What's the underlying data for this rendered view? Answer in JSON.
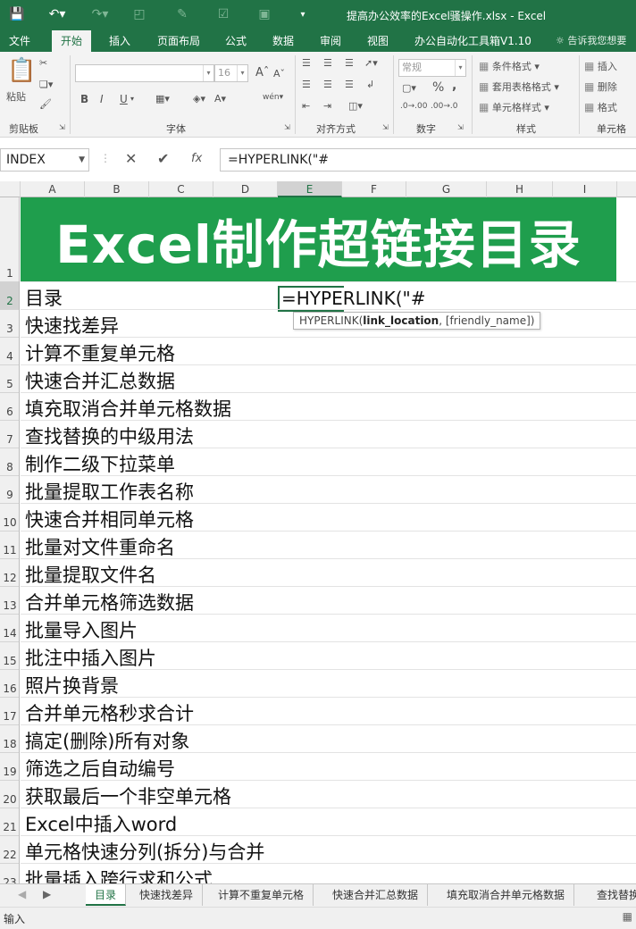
{
  "window": {
    "title": "提高办公效率的Excel骚操作.xlsx - Excel"
  },
  "ribbon_tabs": [
    "文件",
    "开始",
    "插入",
    "页面布局",
    "公式",
    "数据",
    "审阅",
    "视图",
    "办公自动化工具箱V1.10"
  ],
  "tell_me": "告诉我您想要",
  "ribbon": {
    "clipboard": {
      "label": "剪贴板",
      "paste": "粘贴"
    },
    "font": {
      "label": "字体",
      "size": "16",
      "bold": "B",
      "italic": "I",
      "underline": "U",
      "grow": "A",
      "shrink": "A",
      "font_color": "A",
      "phonetic": "wén"
    },
    "alignment": {
      "label": "对齐方式"
    },
    "number": {
      "label": "数字",
      "format": "常规",
      "percent": "%",
      "comma": ",",
      "dec_inc": ".0→.00",
      "dec_dec": ".00→.0"
    },
    "styles": {
      "label": "样式",
      "conditional": "条件格式",
      "table": "套用表格格式",
      "cell": "单元格样式"
    },
    "cells": {
      "label": "单元格",
      "insert": "插入",
      "delete": "删除",
      "format": "格式"
    }
  },
  "formula_bar": {
    "name_box": "INDEX",
    "fx": "fx",
    "cancel": "✕",
    "enter": "✔",
    "formula": "=HYPERLINK(\"#"
  },
  "columns": [
    "A",
    "B",
    "C",
    "D",
    "E",
    "F",
    "G",
    "H",
    "I"
  ],
  "selected_column": "E",
  "rows": [
    "1",
    "2",
    "3",
    "4",
    "5",
    "6",
    "7",
    "8",
    "9",
    "10",
    "11",
    "12",
    "13",
    "14",
    "15",
    "16",
    "17",
    "18",
    "19",
    "20",
    "21",
    "22",
    "23"
  ],
  "banner": "Excel制作超链接目录",
  "column_a": [
    "目录",
    "快速找差异",
    "计算不重复单元格",
    "快速合并汇总数据",
    "填充取消合并单元格数据",
    "查找替换的中级用法",
    "制作二级下拉菜单",
    "批量提取工作表名称",
    "快速合并相同单元格",
    "批量对文件重命名",
    "批量提取文件名",
    "合并单元格筛选数据",
    "批量导入图片",
    "批注中插入图片",
    "照片换背景",
    "合并单元格秒求合计",
    "搞定(删除)所有对象",
    "筛选之后自动编号",
    "获取最后一个非空单元格",
    "Excel中插入word",
    "单元格快速分列(拆分)与合并",
    "批量插入跨行求和公式"
  ],
  "edit_cell": {
    "text": "=HYPERLINK(\"#"
  },
  "tooltip": {
    "fn": "HYPERLINK(",
    "arg1": "link_location",
    "rest": ", [friendly_name])"
  },
  "sheet_tabs": [
    "目录",
    "快速找差异",
    "计算不重复单元格",
    "快速合并汇总数据",
    "填充取消合并单元格数据",
    "查找替换"
  ],
  "status": "输入",
  "colors": {
    "excel_green": "#217346",
    "banner_green": "#1f9e4d"
  }
}
